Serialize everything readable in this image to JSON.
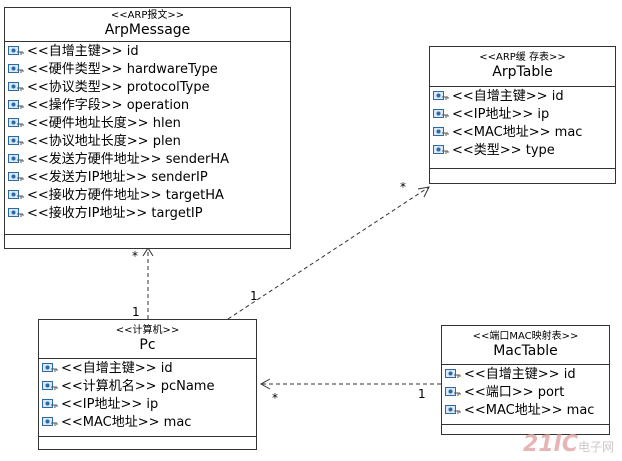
{
  "classes": {
    "arp_message": {
      "stereotype": "<<ARP报文>>",
      "name": "ArpMessage",
      "attributes": [
        {
          "stereo": "<<自增主键>>",
          "field": "id"
        },
        {
          "stereo": "<<硬件类型>>",
          "field": "hardwareType"
        },
        {
          "stereo": "<<协议类型>>",
          "field": "protocolType"
        },
        {
          "stereo": "<<操作字段>>",
          "field": "operation"
        },
        {
          "stereo": "<<硬件地址长度>>",
          "field": "hlen"
        },
        {
          "stereo": "<<协议地址长度>>",
          "field": "plen"
        },
        {
          "stereo": "<<发送方硬件地址>>",
          "field": "senderHA"
        },
        {
          "stereo": "<<发送方IP地址>>",
          "field": "senderIP"
        },
        {
          "stereo": "<<接收方硬件地址>>",
          "field": "targetHA"
        },
        {
          "stereo": "<<接收方IP地址>>",
          "field": "targetIP"
        }
      ]
    },
    "arp_table": {
      "stereotype": "<<ARP缓 存表>>",
      "name": "ArpTable",
      "attributes": [
        {
          "stereo": "<<自增主键>>",
          "field": "id"
        },
        {
          "stereo": "<<IP地址>>",
          "field": "ip"
        },
        {
          "stereo": "<<MAC地址>>",
          "field": "mac"
        },
        {
          "stereo": "<<类型>>",
          "field": "type"
        }
      ]
    },
    "pc": {
      "stereotype": "<<计算机>>",
      "name": "Pc",
      "attributes": [
        {
          "stereo": "<<自增主键>>",
          "field": "id"
        },
        {
          "stereo": "<<计算机名>>",
          "field": "pcName"
        },
        {
          "stereo": "<<IP地址>>",
          "field": "ip"
        },
        {
          "stereo": "<<MAC地址>>",
          "field": "mac"
        }
      ]
    },
    "mac_table": {
      "stereotype": "<<端口MAC映射表>>",
      "name": "MacTable",
      "attributes": [
        {
          "stereo": "<<自增主键>>",
          "field": "id"
        },
        {
          "stereo": "<<端口>>",
          "field": "port"
        },
        {
          "stereo": "<<MAC地址>>",
          "field": "mac"
        }
      ]
    }
  },
  "multiplicities": {
    "pc_arpmessage_near_message": "*",
    "pc_arpmessage_near_pc": "1",
    "pc_arptable_near_pc": "1",
    "pc_arptable_near_table": "*",
    "mactable_pc_near_pc": "*",
    "mactable_pc_near_mactable": "1"
  },
  "watermark": {
    "brand": "21IC",
    "sub": "电子网"
  },
  "colors": {
    "border": "#333333",
    "link": "#333333",
    "icon": "#2a6aa8"
  }
}
